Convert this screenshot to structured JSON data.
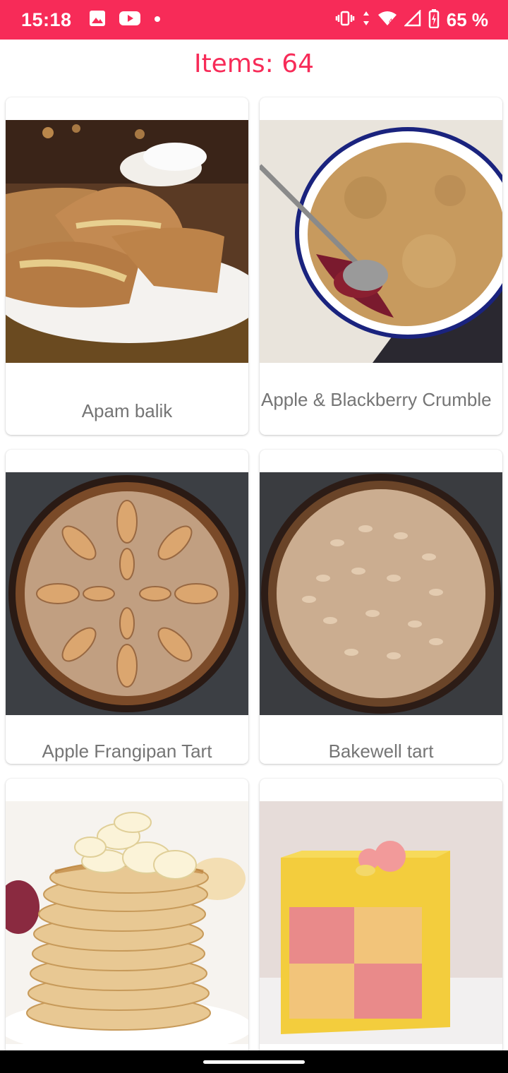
{
  "status_bar": {
    "time": "15:18",
    "battery_text": "65 %",
    "icons": [
      "image-icon",
      "youtube-icon",
      "dot-icon",
      "vibrate-icon",
      "data-arrows-icon",
      "wifi-icon",
      "signal-icon",
      "battery-icon"
    ],
    "color": "#f72b58"
  },
  "header": {
    "title": "Items: 64"
  },
  "items": [
    {
      "name": "Apam balik"
    },
    {
      "name": "Apple & Blackberry Crumble"
    },
    {
      "name": "Apple Frangipan Tart"
    },
    {
      "name": "Bakewell tart"
    },
    {
      "name": ""
    },
    {
      "name": ""
    }
  ]
}
